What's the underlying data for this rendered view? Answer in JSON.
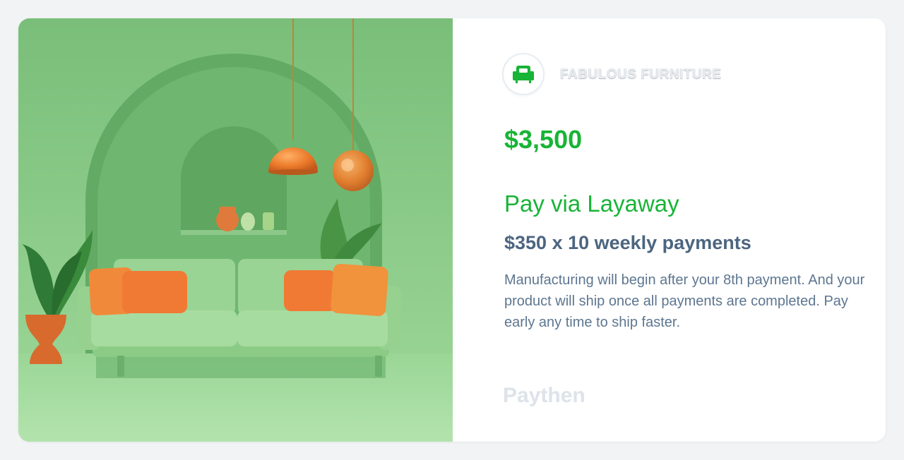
{
  "merchant": {
    "name": "FABULOUS FURNITURE",
    "logo_icon": "armchair-icon",
    "brand_color": "#18b436"
  },
  "offer": {
    "price": "$3,500",
    "method": "Pay via Layaway",
    "schedule": "$350 x 10 weekly payments",
    "note": "Manufacturing will begin after your 8th payment. And your product will ship once all payments are completed. Pay early any time to ship faster."
  },
  "provider": {
    "name": "Paythen"
  },
  "colors": {
    "accent_green": "#18b436",
    "heading_slate": "#4c6580",
    "body_slate": "#5d7690",
    "provider_gray": "#dde3ea"
  }
}
